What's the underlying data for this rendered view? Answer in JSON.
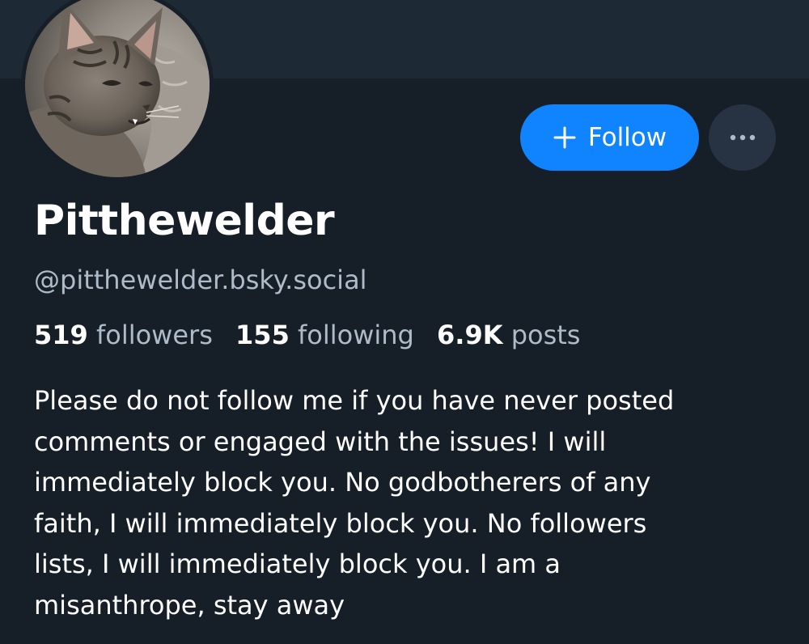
{
  "profile": {
    "display_name": "Pitthewelder",
    "handle": "@pitthewelder.bsky.social",
    "avatar_icon": "kitten-avatar",
    "follow_label": "Follow",
    "follow_icon": "plus-icon",
    "more_icon": "ellipsis-icon",
    "stats": {
      "followers_count": "519",
      "followers_label": "followers",
      "following_count": "155",
      "following_label": "following",
      "posts_count": "6.9K",
      "posts_label": "posts"
    },
    "bio": "Please do not follow me if you have never posted\ncomments or engaged with the issues! I will\nimmediately block you. No godbotherers of any\nfaith, I will immediately block you. No followers\nlists, I will immediately block you. I am a\nmisanthrope,  stay away"
  },
  "colors": {
    "background": "#161e27",
    "banner": "#1e2936",
    "accent": "#1083fe",
    "secondary_button": "#273342",
    "muted_text": "#aebbc9",
    "primary_text": "#ffffff"
  }
}
